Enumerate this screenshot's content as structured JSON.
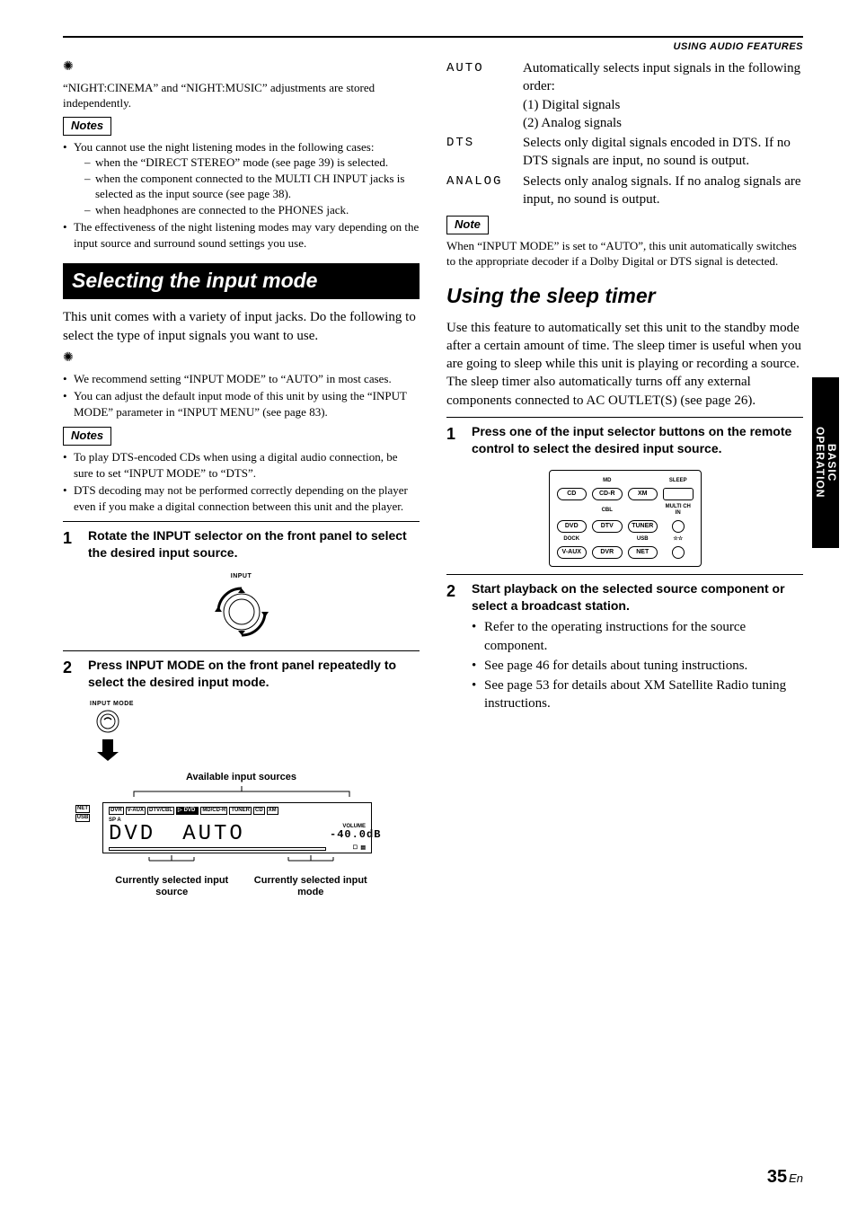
{
  "header": {
    "section": "USING AUDIO FEATURES"
  },
  "sideTab": {
    "line1": "BASIC",
    "line2": "OPERATION"
  },
  "pageNumber": {
    "num": "35",
    "suffix": "En"
  },
  "left": {
    "tip1": "“NIGHT:CINEMA” and “NIGHT:MUSIC” adjustments are stored independently.",
    "notesLabel": "Notes",
    "note_cannot": "You cannot use the night listening modes in the following cases:",
    "dash1": "when the “DIRECT STEREO” mode (see page 39) is selected.",
    "dash2": "when the component connected to the MULTI CH INPUT jacks is selected as the input source (see page 38).",
    "dash3": "when headphones are connected to the PHONES jack.",
    "note_eff": "The effectiveness of the night listening modes may vary depending on the input source and surround sound settings you use.",
    "h_input": "Selecting the input mode",
    "p_input": "This unit comes with a variety of input jacks. Do the following to select the type of input signals you want to use.",
    "tip_rec": "We recommend setting “INPUT MODE” to “AUTO” in most cases.",
    "tip_adj": "You can adjust the default input mode of this unit by using the “INPUT MODE” parameter in “INPUT MENU” (see page 83).",
    "note_dts1": "To play DTS-encoded CDs when using a digital audio connection, be sure to set “INPUT MODE” to “DTS”.",
    "note_dts2": "DTS decoding may not be performed correctly depending on the player even if you make a digital connection between this unit and the player.",
    "step1": "Rotate the INPUT selector on the front panel to select the desired input source.",
    "knobLabel": "INPUT",
    "step2": "Press INPUT MODE on the front panel repeatedly to select the desired input mode.",
    "inputModeLabel": "INPUT MODE",
    "availLabel": "Available input sources",
    "sources": [
      "NET",
      "USB",
      "DVR",
      "V-AUX",
      "DTV/CBL",
      "DVD",
      "MD/CD-R",
      "TUNER",
      "CD",
      "XM"
    ],
    "spA": "SP A",
    "seg_src": "DVD",
    "seg_mode": "AUTO",
    "volLabel": "VOLUME",
    "volVal": "-40.0dB",
    "cap_src": "Currently selected input source",
    "cap_mode": "Currently selected input mode"
  },
  "right": {
    "modes": [
      {
        "label": "AUTO",
        "desc": "Automatically selects input signals in the following order:",
        "sub1": "(1) Digital signals",
        "sub2": "(2) Analog signals"
      },
      {
        "label": "DTS",
        "desc": "Selects only digital signals encoded in DTS. If no DTS signals are input, no sound is output."
      },
      {
        "label": "ANALOG",
        "desc": "Selects only analog signals. If no analog signals are input, no sound is output."
      }
    ],
    "noteLabel": "Note",
    "noteText": "When “INPUT MODE” is set to “AUTO”, this unit automatically switches to the appropriate decoder if a Dolby Digital or DTS signal is detected.",
    "h_sleep": "Using the sleep timer",
    "p_sleep": "Use this feature to automatically set this unit to the standby mode after a certain amount of time. The sleep timer is useful when you are going to sleep while this unit is playing or recording a source. The sleep timer also automatically turns off any external components connected to AC OUTLET(S) (see page 26).",
    "step1": "Press one of the input selector buttons on the remote control to select the desired input source.",
    "remote": {
      "labels": {
        "md": "MD",
        "cbl": "CBL",
        "sleep": "SLEEP",
        "multi": "MULTI CH IN",
        "dock": "DOCK",
        "usb": "USB"
      },
      "btns": {
        "cd": "CD",
        "cdr": "CD-R",
        "xm": "XM",
        "dvd": "DVD",
        "dtv": "DTV",
        "tuner": "TUNER",
        "vaux": "V-AUX",
        "dvr": "DVR",
        "net": "NET"
      },
      "stars": "☆☆"
    },
    "step2": "Start playback on the selected source component or select a broadcast station.",
    "b1": "Refer to the operating instructions for the source component.",
    "b2": "See page 46 for details about tuning instructions.",
    "b3": "See page 53 for details about XM Satellite Radio tuning instructions."
  }
}
